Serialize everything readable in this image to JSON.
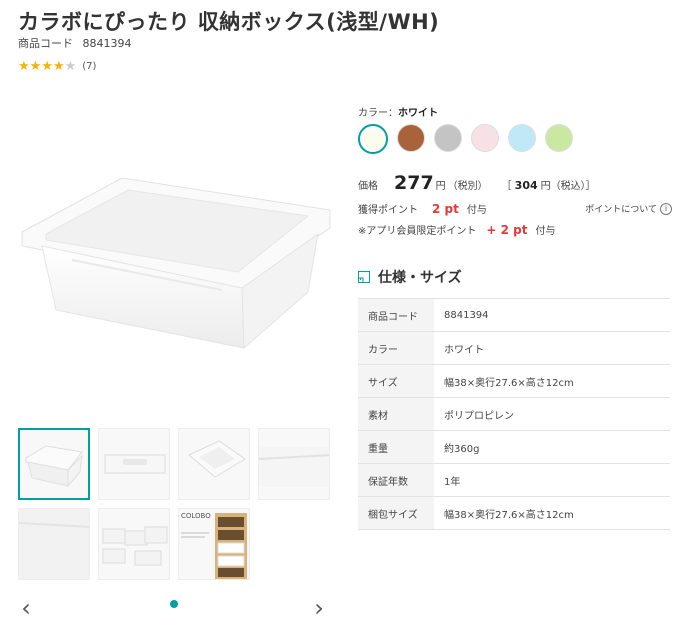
{
  "product": {
    "title": "カラボにぴったり 収納ボックス(浅型/WH)",
    "code_label": "商品コード",
    "code_value": "8841394",
    "rating_count": "(7)",
    "rating_value": 4.5
  },
  "gallery": {
    "thumb_count": 7,
    "thumb_logo_text": "COLOBO"
  },
  "color": {
    "label": "カラー：",
    "selected": "ホワイト",
    "swatches": [
      "#fbfbee",
      "#a8633a",
      "#c4c4c4",
      "#f8e1e6",
      "#bfe9f7",
      "#c9e9a3"
    ]
  },
  "price": {
    "label": "価格",
    "value": "277",
    "unit": "円",
    "tax_note": "（税別）",
    "taxin_open": "［",
    "taxin_value": "304",
    "taxin_unit": "円（税込）",
    "taxin_close": "］"
  },
  "points": {
    "label": "獲得ポイント",
    "value": "2 pt",
    "suffix": "付与",
    "about": "ポイントについて",
    "app_label": "※アプリ会員限定ポイント",
    "app_value": "+ 2 pt",
    "app_suffix": "付与"
  },
  "spec": {
    "title": "仕様・サイズ",
    "rows": [
      {
        "k": "商品コード",
        "v": "8841394"
      },
      {
        "k": "カラー",
        "v": "ホワイト"
      },
      {
        "k": "サイズ",
        "v": "幅38×奥行27.6×高さ12cm"
      },
      {
        "k": "素材",
        "v": "ポリプロピレン"
      },
      {
        "k": "重量",
        "v": "約360g"
      },
      {
        "k": "保証年数",
        "v": "1年"
      },
      {
        "k": "梱包サイズ",
        "v": "幅38×奥行27.6×高さ12cm"
      }
    ]
  },
  "colors": {
    "accent": "#00a0a0",
    "star": "#f5b301",
    "point_red": "#e53935"
  }
}
